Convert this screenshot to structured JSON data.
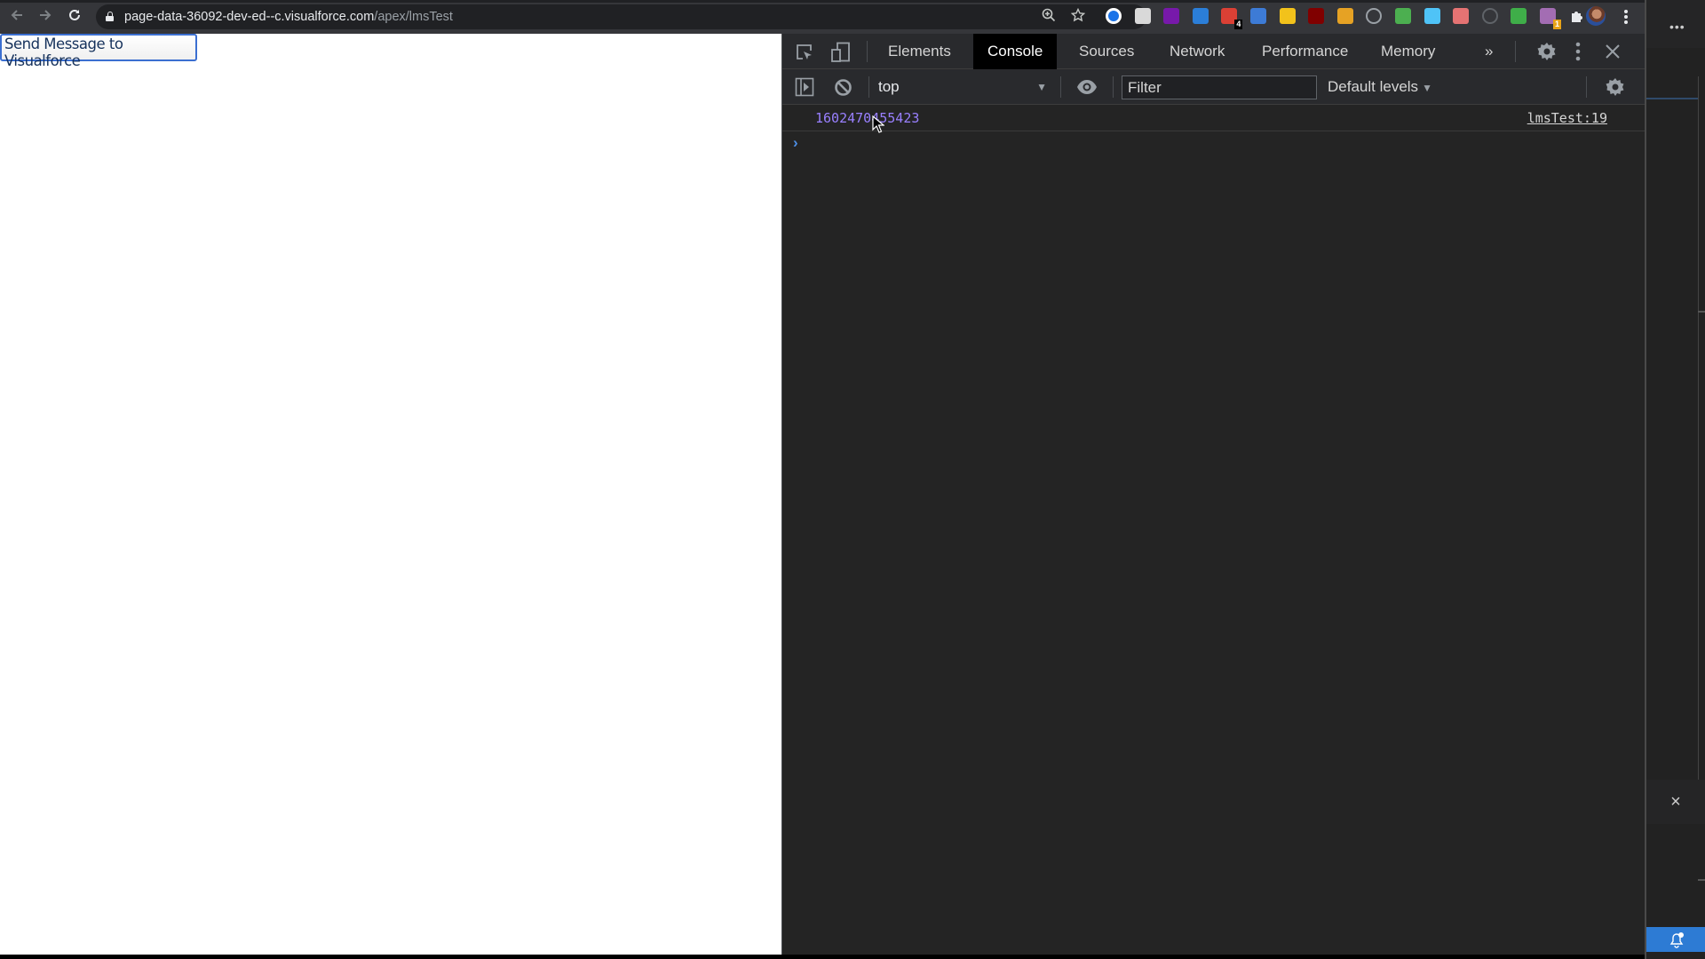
{
  "browser": {
    "url_host": "page-data-36092-dev-ed--c.visualforce.com",
    "url_path": "/apex/lmsTest",
    "nav": {
      "back_icon": "arrow-left-icon",
      "forward_icon": "arrow-right-icon",
      "reload_icon": "reload-icon"
    },
    "omnibox_icons": [
      "zoom-icon",
      "bookmark-star-icon"
    ],
    "extensions": [
      {
        "name": "1password-extension",
        "color": "#1a73e8"
      },
      {
        "name": "page-ruler-extension",
        "color": "#d9d9d9"
      },
      {
        "name": "onenote-extension",
        "color": "#7719aa"
      },
      {
        "name": "todo-extension",
        "color": "#2b7ed8"
      },
      {
        "name": "todoist-extension",
        "color": "#db4035",
        "badge": "4"
      },
      {
        "name": "salesforce-inspector-extension",
        "color": "#3d7bd6"
      },
      {
        "name": "resize-extension",
        "color": "#f2c21b"
      },
      {
        "name": "ublock-extension",
        "color": "#800000"
      },
      {
        "name": "k-extension",
        "color": "#e6a224"
      },
      {
        "name": "copy-extension",
        "color": "#9aa0a6"
      },
      {
        "name": "cloud-extension",
        "color": "#4caf50"
      },
      {
        "name": "share-extension",
        "color": "#4fc3f7"
      },
      {
        "name": "chart-extension",
        "color": "#e57373"
      },
      {
        "name": "pen-extension",
        "color": "#5f6368"
      },
      {
        "name": "arrow-extension",
        "color": "#3fae49"
      },
      {
        "name": "screenshot-extension",
        "color": "#a36db3",
        "badge": "1"
      },
      {
        "name": "extensions-puzzle",
        "color": "#e8eaed"
      }
    ]
  },
  "page": {
    "send_button_label": "Send Message to Visualforce"
  },
  "devtools": {
    "tabs": [
      {
        "label": "Elements",
        "active": false
      },
      {
        "label": "Console",
        "active": true
      },
      {
        "label": "Sources",
        "active": false
      },
      {
        "label": "Network",
        "active": false
      },
      {
        "label": "Performance",
        "active": false
      },
      {
        "label": "Memory",
        "active": false
      }
    ],
    "more_tabs_label": "»",
    "console_bar": {
      "context": "top",
      "filter_placeholder": "Filter",
      "filter_value": "",
      "levels_label": "Default levels"
    },
    "messages": [
      {
        "text": "1602470455423",
        "source": "lmsTest:19"
      }
    ],
    "prompt_symbol": "›"
  },
  "right_app": {
    "menu_label": "•••",
    "close_label": "×"
  }
}
